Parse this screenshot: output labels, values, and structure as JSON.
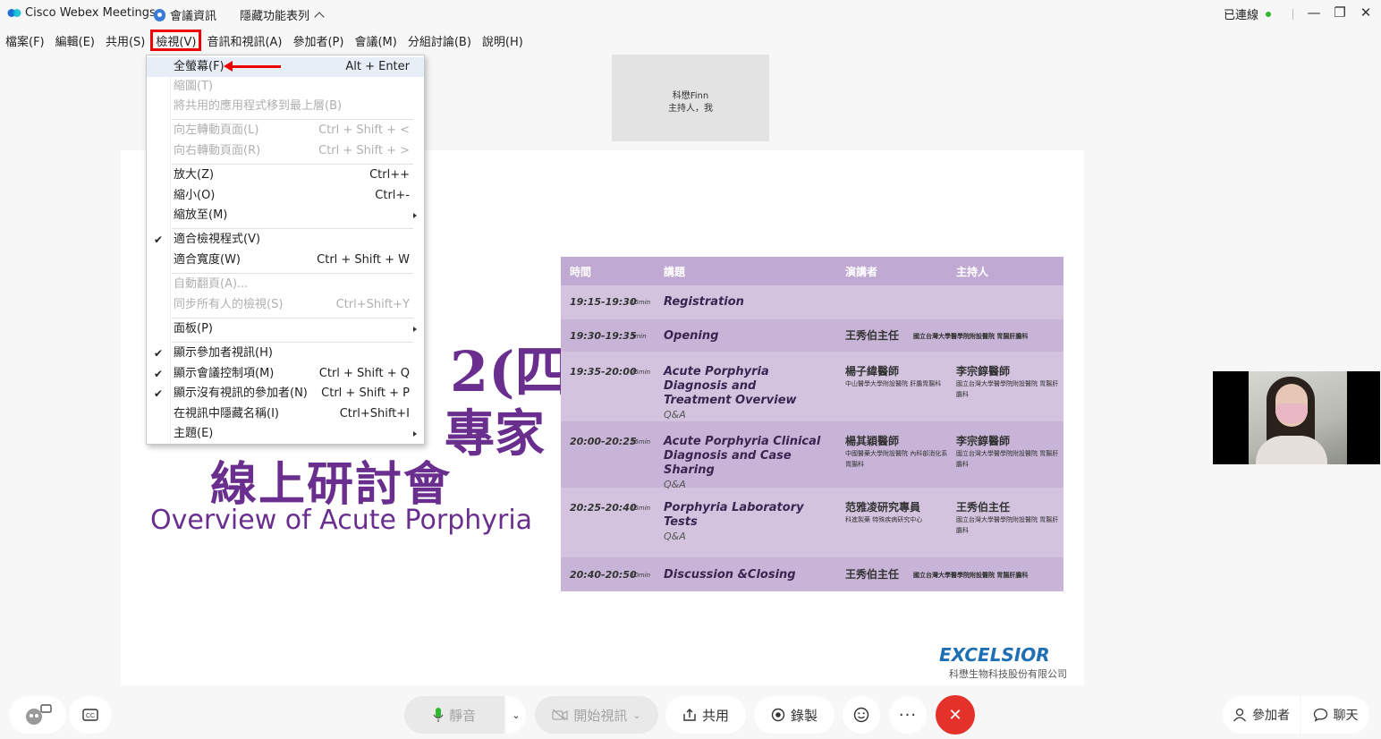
{
  "titlebar": {
    "app_title": "Cisco Webex Meetings",
    "meeting_info": "會議資訊",
    "hidden_features": "隱藏功能表列",
    "connection_status": "已連線",
    "minimize": "—",
    "restore": "❐",
    "close": "✕"
  },
  "menubar": {
    "file": "檔案(F)",
    "edit": "編輯(E)",
    "share": "共用(S)",
    "view": "檢視(V)",
    "audio_video": "音訊和視訊(A)",
    "participants": "參加者(P)",
    "meeting": "會議(M)",
    "breakout": "分組討論(B)",
    "help": "說明(H)"
  },
  "view_menu": {
    "fullscreen": {
      "label": "全螢幕(F)",
      "shortcut": "Alt + Enter"
    },
    "thumbnails": {
      "label": "縮圖(T)"
    },
    "bring_shared_top": {
      "label": "將共用的應用程式移到最上層(B)"
    },
    "rotate_left": {
      "label": "向左轉動頁面(L)",
      "shortcut": "Ctrl + Shift + <"
    },
    "rotate_right": {
      "label": "向右轉動頁面(R)",
      "shortcut": "Ctrl + Shift + >"
    },
    "zoom_in": {
      "label": "放大(Z)",
      "shortcut": "Ctrl++"
    },
    "zoom_out": {
      "label": "縮小(O)",
      "shortcut": "Ctrl+-"
    },
    "zoom_to": {
      "label": "縮放至(M)"
    },
    "fit_viewer": {
      "label": "適合檢視程式(V)"
    },
    "fit_width": {
      "label": "適合寬度(W)",
      "shortcut": "Ctrl + Shift + W"
    },
    "auto_page": {
      "label": "自動翻頁(A)..."
    },
    "sync_view": {
      "label": "同步所有人的檢視(S)",
      "shortcut": "Ctrl+Shift+Y"
    },
    "panels": {
      "label": "面板(P)"
    },
    "show_participant_video": {
      "label": "顯示參加者視訊(H)"
    },
    "show_meeting_controls": {
      "label": "顯示會議控制項(M)",
      "shortcut": "Ctrl + Shift + Q"
    },
    "show_no_video_participants": {
      "label": "顯示沒有視訊的參加者(N)",
      "shortcut": "Ctrl + Shift + P"
    },
    "hide_names": {
      "label": "在視訊中隱藏名稱(I)",
      "shortcut": "Ctrl+Shift+I"
    },
    "theme": {
      "label": "主題(E)"
    }
  },
  "host_tile": {
    "name": "科懋Finn",
    "role": "主持人，我"
  },
  "slide": {
    "big_line1": "2(四)",
    "big_line2": "專家",
    "big_line3": "線上研討會",
    "english_title": "Overview of Acute Porphyria",
    "agenda_headers": [
      "時間",
      "講題",
      "演講者",
      "主持人"
    ],
    "agenda_rows": [
      {
        "time": "19:15-19:30",
        "dur": "15min",
        "topic": "Registration",
        "sub": "",
        "speaker": "",
        "speaker_aff": "",
        "host": "",
        "host_aff": ""
      },
      {
        "time": "19:30-19:35",
        "dur": "5min",
        "topic": "Opening",
        "sub": "",
        "speaker": "王秀伯主任",
        "speaker_aff": "國立台灣大學醫學院附設醫院 胃腸肝膽科",
        "host": "",
        "host_aff": ""
      },
      {
        "time": "19:35-20:00",
        "dur": "25min",
        "topic": "Acute Porphyria Diagnosis and Treatment Overview",
        "sub": "Q&A",
        "speaker": "楊子緯醫師",
        "speaker_aff": "中山醫學大學附設醫院 肝膽胃腸科",
        "host": "李宗錞醫師",
        "host_aff": "國立台灣大學醫學院附設醫院 胃腸肝膽科"
      },
      {
        "time": "20:00-20:25",
        "dur": "25min",
        "topic": "Acute Porphyria Clinical Diagnosis and Case Sharing",
        "sub": "Q&A",
        "speaker": "楊其穎醫師",
        "speaker_aff": "中國醫藥大學附設醫院 內科部消化系胃腸科",
        "host": "李宗錞醫師",
        "host_aff": "國立台灣大學醫學院附設醫院 胃腸肝膽科"
      },
      {
        "time": "20:25-20:40",
        "dur": "15min",
        "topic": "Porphyria Laboratory Tests",
        "sub": "Q&A",
        "speaker": "范雅凌研究專員",
        "speaker_aff": "科進製藥 特殊疾病研究中心",
        "host": "王秀伯主任",
        "host_aff": "國立台灣大學醫學院附設醫院 胃腸肝膽科"
      },
      {
        "time": "20:40-20:50",
        "dur": "10min",
        "topic": "Discussion &Closing",
        "sub": "",
        "speaker": "王秀伯主任",
        "speaker_aff": "國立台灣大學醫學院附設醫院 胃腸肝膽科",
        "host": "",
        "host_aff": ""
      }
    ],
    "logo_text": "EXCELSIOR",
    "logo_sub": "科懋生物科技股份有限公司"
  },
  "toolbar": {
    "mute": "靜音",
    "start_video": "開始視訊",
    "share": "共用",
    "record": "錄製",
    "participants": "參加者",
    "chat": "聊天"
  },
  "colors": {
    "accent_red": "#e00000",
    "slide_purple": "#6a2e8f",
    "agenda_bg": "#d3c3df",
    "end_button": "#e4322b",
    "status_green": "#2eb82e"
  }
}
